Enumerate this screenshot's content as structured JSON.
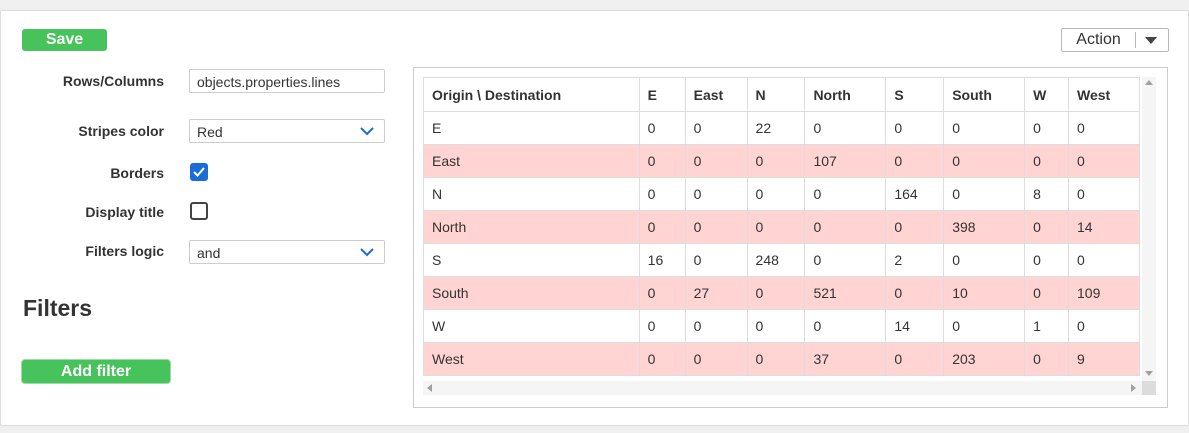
{
  "toolbar": {
    "save_label": "Save",
    "action_label": "Action"
  },
  "settings": {
    "rows_columns": {
      "label": "Rows/Columns",
      "value": "objects.properties.lines"
    },
    "stripes_color": {
      "label": "Stripes color",
      "value": "Red"
    },
    "borders": {
      "label": "Borders",
      "checked": true
    },
    "display_title": {
      "label": "Display title",
      "checked": false
    },
    "filters_logic": {
      "label": "Filters logic",
      "value": "and"
    }
  },
  "filters": {
    "heading": "Filters",
    "add_label": "Add filter"
  },
  "colors": {
    "accent_green": "#46c35a",
    "stripe": "#ffd4d2",
    "checkbox_blue": "#1a6dd6"
  },
  "table": {
    "headers": [
      "Origin \\ Destination",
      "E",
      "East",
      "N",
      "North",
      "S",
      "South",
      "W",
      "West"
    ],
    "rows": [
      [
        "E",
        "0",
        "0",
        "22",
        "0",
        "0",
        "0",
        "0",
        "0"
      ],
      [
        "East",
        "0",
        "0",
        "0",
        "107",
        "0",
        "0",
        "0",
        "0"
      ],
      [
        "N",
        "0",
        "0",
        "0",
        "0",
        "164",
        "0",
        "8",
        "0"
      ],
      [
        "North",
        "0",
        "0",
        "0",
        "0",
        "0",
        "398",
        "0",
        "14"
      ],
      [
        "S",
        "16",
        "0",
        "248",
        "0",
        "2",
        "0",
        "0",
        "0"
      ],
      [
        "South",
        "0",
        "27",
        "0",
        "521",
        "0",
        "10",
        "0",
        "109"
      ],
      [
        "W",
        "0",
        "0",
        "0",
        "0",
        "14",
        "0",
        "1",
        "0"
      ],
      [
        "West",
        "0",
        "0",
        "0",
        "37",
        "0",
        "203",
        "0",
        "9"
      ]
    ]
  }
}
